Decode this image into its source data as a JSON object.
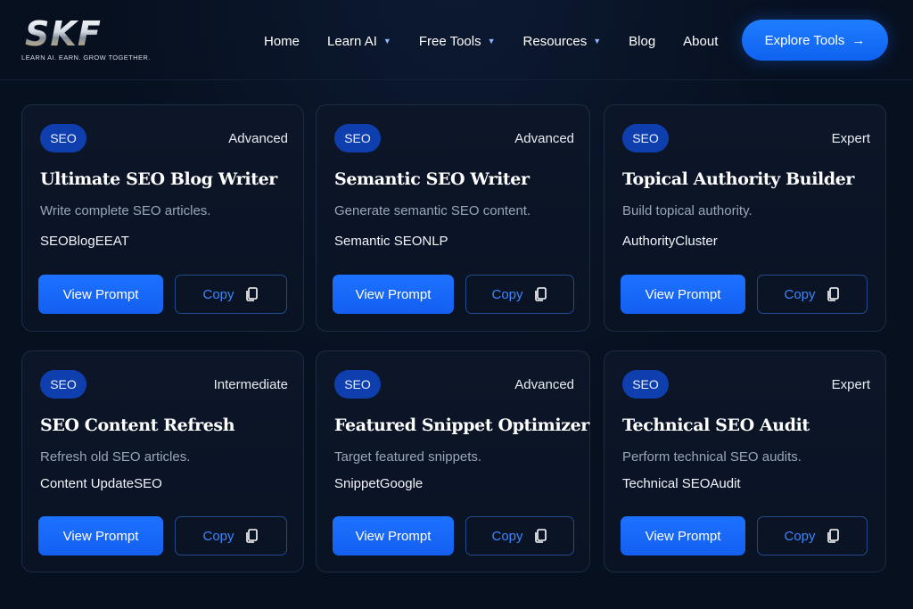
{
  "header": {
    "logo_text": "SKF",
    "tagline": "LEARN AI. EARN. GROW TOGETHER.",
    "nav": [
      {
        "label": "Home",
        "dropdown": false
      },
      {
        "label": "Learn AI",
        "dropdown": true
      },
      {
        "label": "Free Tools",
        "dropdown": true
      },
      {
        "label": "Resources",
        "dropdown": true
      },
      {
        "label": "Blog",
        "dropdown": false
      },
      {
        "label": "About",
        "dropdown": false
      }
    ],
    "cta_label": "Explore Tools",
    "cta_icon": "arrow-right-icon"
  },
  "cards": [
    {
      "badge": "SEO",
      "level": "Advanced",
      "title": "Ultimate SEO Blog Writer",
      "description": "Write complete SEO articles.",
      "tags": "SEOBlogEEAT",
      "view_label": "View Prompt",
      "copy_label": "Copy"
    },
    {
      "badge": "SEO",
      "level": "Advanced",
      "title": "Semantic SEO Writer",
      "description": "Generate semantic SEO content.",
      "tags": "Semantic SEONLP",
      "view_label": "View Prompt",
      "copy_label": "Copy"
    },
    {
      "badge": "SEO",
      "level": "Expert",
      "title": "Topical Authority Builder",
      "description": "Build topical authority.",
      "tags": "AuthorityCluster",
      "view_label": "View Prompt",
      "copy_label": "Copy"
    },
    {
      "badge": "SEO",
      "level": "Intermediate",
      "title": "SEO Content Refresh",
      "description": "Refresh old SEO articles.",
      "tags": "Content UpdateSEO",
      "view_label": "View Prompt",
      "copy_label": "Copy"
    },
    {
      "badge": "SEO",
      "level": "Advanced",
      "title": "Featured Snippet Optimizer",
      "description": "Target featured snippets.",
      "tags": "SnippetGoogle",
      "view_label": "View Prompt",
      "copy_label": "Copy"
    },
    {
      "badge": "SEO",
      "level": "Expert",
      "title": "Technical SEO Audit",
      "description": "Perform technical SEO audits.",
      "tags": "Technical SEOAudit",
      "view_label": "View Prompt",
      "copy_label": "Copy"
    }
  ],
  "colors": {
    "background": "#07101f",
    "card_border": "#1e2b45",
    "primary_button": "#1d72ff",
    "badge": "#0f3fae",
    "copy_text": "#3d86ff"
  }
}
